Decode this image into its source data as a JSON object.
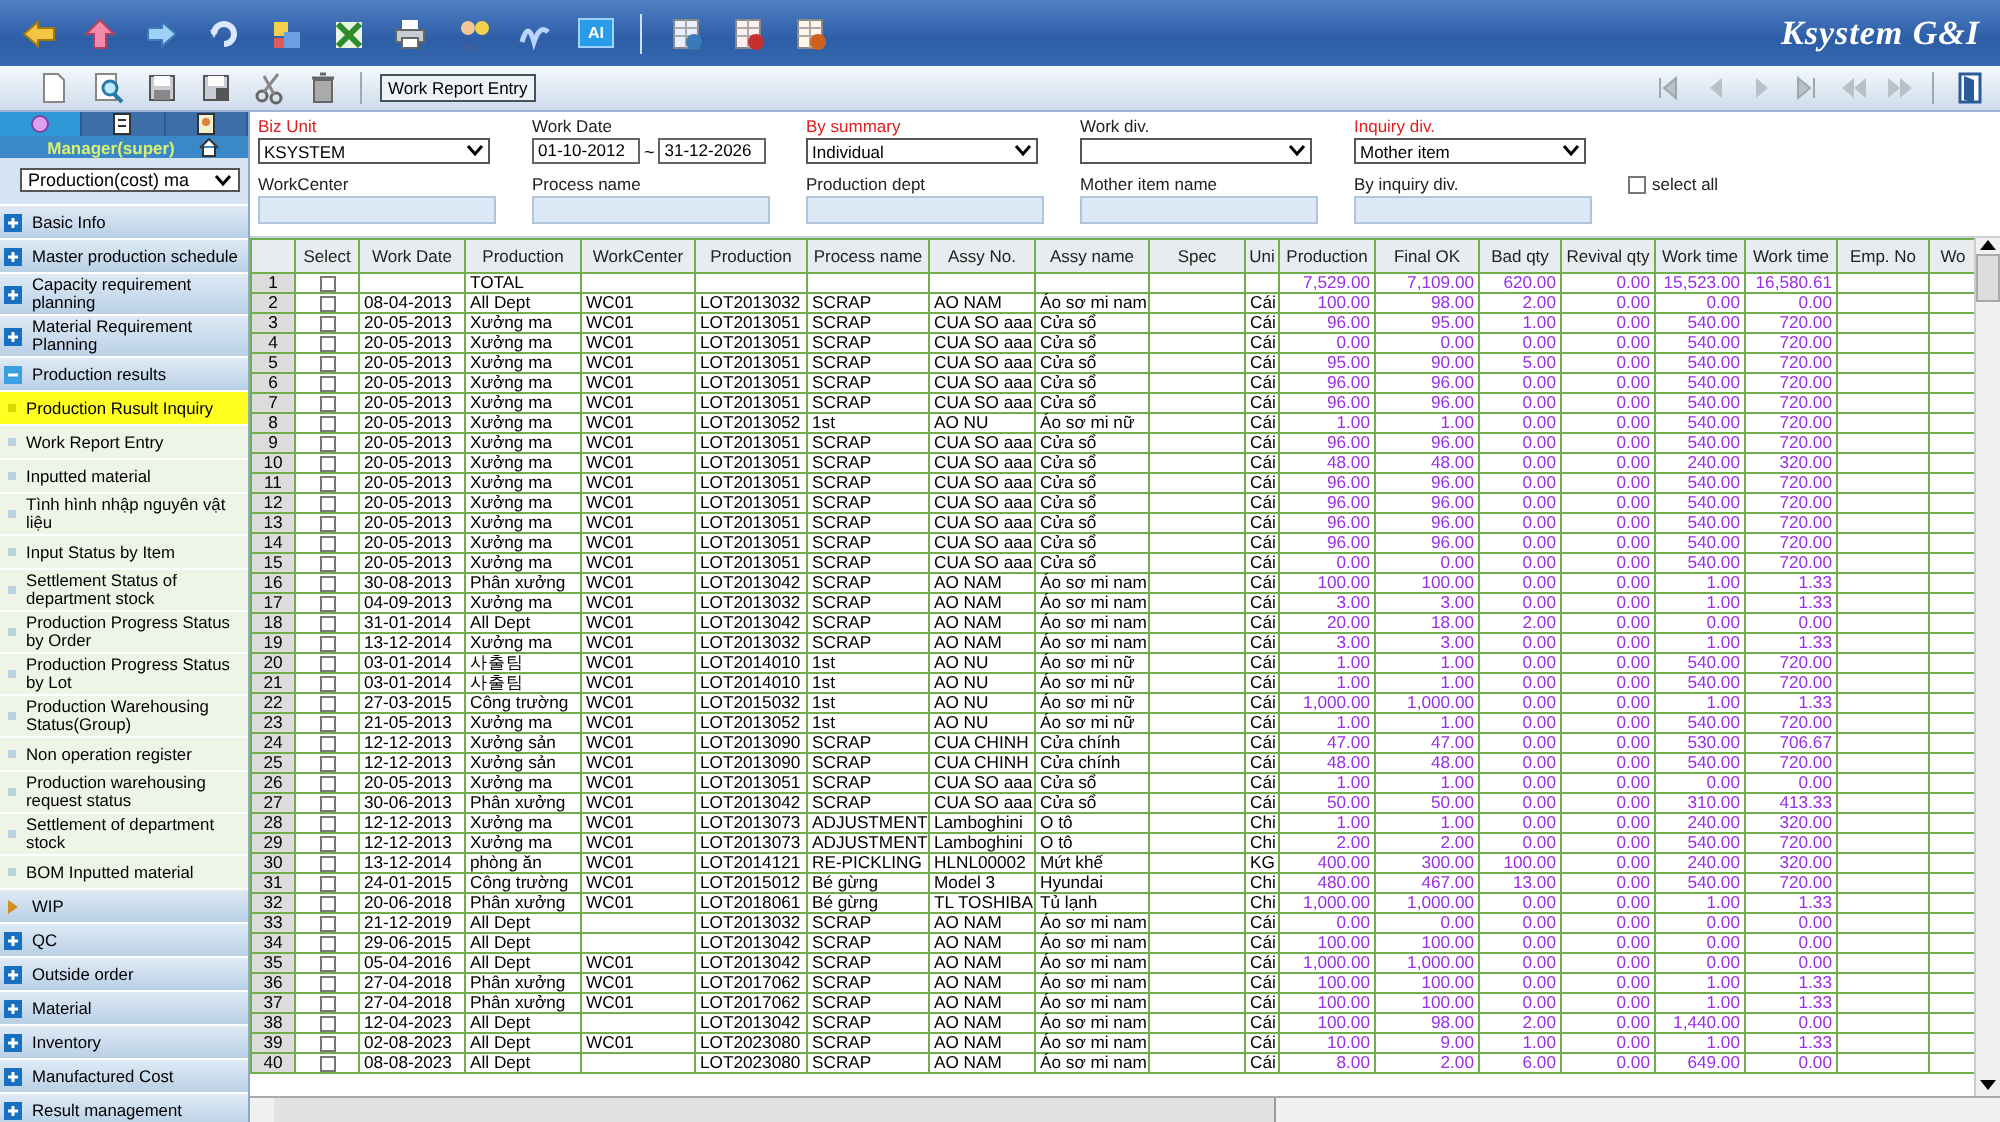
{
  "app_bar": {
    "ai_label": "AI",
    "logo": "Ksystem G&I"
  },
  "action_bar": {
    "screen_button": "Work Report Entry"
  },
  "sidebar": {
    "tabs": [
      {
        "selected": true
      },
      {
        "selected": false
      },
      {
        "selected": false
      }
    ],
    "user": "Manager(super)",
    "module_select": "Production(cost) ma",
    "items": [
      {
        "label": "Basic Info",
        "kind": "module",
        "expanded": false
      },
      {
        "label": "Master production schedule",
        "kind": "module",
        "expanded": false
      },
      {
        "label": "Capacity requirement planning",
        "kind": "module",
        "expanded": false
      },
      {
        "label": "Material Requirement Planning",
        "kind": "module",
        "expanded": false
      },
      {
        "label": "Production results",
        "kind": "module",
        "expanded": true,
        "children": [
          {
            "label": "Production Rusult Inquiry",
            "selected": true
          },
          {
            "label": "Work Report Entry",
            "selected": false
          },
          {
            "label": "Inputted material",
            "selected": false
          },
          {
            "label": "Tình hình nhập nguyên vật liệu",
            "selected": false
          },
          {
            "label": "Input Status by Item",
            "selected": false
          },
          {
            "label": "Settlement Status of department stock",
            "selected": false
          },
          {
            "label": "Production Progress Status by Order",
            "selected": false
          },
          {
            "label": "Production Progress Status by Lot",
            "selected": false
          },
          {
            "label": "Production Warehousing Status(Group)",
            "selected": false
          },
          {
            "label": "Non operation register",
            "selected": false
          },
          {
            "label": "Production warehousing request status",
            "selected": false
          },
          {
            "label": "Settlement of department stock",
            "selected": false
          },
          {
            "label": "BOM Inputted material",
            "selected": false
          }
        ]
      },
      {
        "label": "WIP",
        "kind": "folder",
        "expanded": false
      },
      {
        "label": "QC",
        "kind": "module",
        "expanded": false
      },
      {
        "label": "Outside order",
        "kind": "module",
        "expanded": false
      },
      {
        "label": "Material",
        "kind": "module",
        "expanded": false
      },
      {
        "label": "Inventory",
        "kind": "module",
        "expanded": false
      },
      {
        "label": "Manufactured Cost",
        "kind": "module",
        "expanded": false
      },
      {
        "label": "Result management",
        "kind": "module",
        "expanded": false
      }
    ]
  },
  "filters": [
    {
      "label": "Biz Unit",
      "required": true,
      "kind": "select",
      "value": "KSYSTEM"
    },
    {
      "label": "Work Date",
      "required": false,
      "kind": "date_range",
      "from": "01-10-2012",
      "separator": "~",
      "to": "31-12-2026"
    },
    {
      "label": "By summary",
      "required": true,
      "kind": "select",
      "value": "Individual"
    },
    {
      "label": "Work div.",
      "required": false,
      "kind": "select"
    },
    {
      "label": "Inquiry div.",
      "required": true,
      "kind": "select",
      "value": "Mother item"
    },
    {
      "label": "WorkCenter",
      "required": false,
      "kind": "text"
    },
    {
      "label": "Process name",
      "required": false,
      "kind": "text"
    },
    {
      "label": "Production dept",
      "required": false,
      "kind": "text"
    },
    {
      "label": "Mother item name",
      "required": false,
      "kind": "text"
    },
    {
      "label": "By inquiry div.",
      "required": false,
      "kind": "text"
    },
    {
      "label": "select all",
      "kind": "checkbox",
      "checked": false
    }
  ],
  "table": {
    "columns": [
      {
        "kind": "rownum"
      },
      {
        "label": "Select",
        "kind": "check"
      },
      {
        "label": "Work Date",
        "kind": "text"
      },
      {
        "label": "Production",
        "kind": "text"
      },
      {
        "label": "WorkCenter",
        "kind": "text"
      },
      {
        "label": "Production",
        "kind": "text"
      },
      {
        "label": "Process name",
        "kind": "text"
      },
      {
        "label": "Assy No.",
        "kind": "text"
      },
      {
        "label": "Assy name",
        "kind": "text"
      },
      {
        "label": "Spec",
        "kind": "text"
      },
      {
        "label": "Uni",
        "kind": "text"
      },
      {
        "label": "Production",
        "kind": "number"
      },
      {
        "label": "Final OK",
        "kind": "number"
      },
      {
        "label": "Bad qty",
        "kind": "number"
      },
      {
        "label": "Revival qty",
        "kind": "number"
      },
      {
        "label": "Work time",
        "kind": "number"
      },
      {
        "label": "Work time",
        "kind": "number"
      },
      {
        "label": "Emp. No",
        "kind": "text"
      },
      {
        "label": "Wo",
        "kind": "text"
      }
    ],
    "rows": [
      {
        "checked": false,
        "cells": [
          "1",
          null,
          null,
          "TOTAL",
          null,
          null,
          null,
          null,
          null,
          null,
          null,
          "7,529.00",
          "7,109.00",
          "620.00",
          "0.00",
          "15,523.00",
          "16,580.61"
        ]
      },
      {
        "checked": false,
        "cells": [
          "2",
          null,
          "08-04-2013",
          "All Dept",
          "WC01",
          "LOT2013032",
          "SCRAP",
          "AO NAM",
          "Áo sơ mi nam",
          null,
          "Cái",
          "100.00",
          "98.00",
          "2.00",
          "0.00",
          "0.00",
          "0.00"
        ]
      },
      {
        "checked": false,
        "cells": [
          "3",
          null,
          "20-05-2013",
          "Xưởng ma",
          "WC01",
          "LOT2013051",
          "SCRAP",
          "CUA SO aaa",
          "Cửa sổ",
          null,
          "Cái",
          "96.00",
          "95.00",
          "1.00",
          "0.00",
          "540.00",
          "720.00"
        ]
      },
      {
        "checked": false,
        "cells": [
          "4",
          null,
          "20-05-2013",
          "Xưởng ma",
          "WC01",
          "LOT2013051",
          "SCRAP",
          "CUA SO aaa",
          "Cửa sổ",
          null,
          "Cái",
          "0.00",
          "0.00",
          "0.00",
          "0.00",
          "540.00",
          "720.00"
        ]
      },
      {
        "checked": false,
        "cells": [
          "5",
          null,
          "20-05-2013",
          "Xưởng ma",
          "WC01",
          "LOT2013051",
          "SCRAP",
          "CUA SO aaa",
          "Cửa sổ",
          null,
          "Cái",
          "95.00",
          "90.00",
          "5.00",
          "0.00",
          "540.00",
          "720.00"
        ]
      },
      {
        "checked": false,
        "cells": [
          "6",
          null,
          "20-05-2013",
          "Xưởng ma",
          "WC01",
          "LOT2013051",
          "SCRAP",
          "CUA SO aaa",
          "Cửa sổ",
          null,
          "Cái",
          "96.00",
          "96.00",
          "0.00",
          "0.00",
          "540.00",
          "720.00"
        ]
      },
      {
        "checked": false,
        "cells": [
          "7",
          null,
          "20-05-2013",
          "Xưởng ma",
          "WC01",
          "LOT2013051",
          "SCRAP",
          "CUA SO aaa",
          "Cửa sổ",
          null,
          "Cái",
          "96.00",
          "96.00",
          "0.00",
          "0.00",
          "540.00",
          "720.00"
        ]
      },
      {
        "checked": false,
        "cells": [
          "8",
          null,
          "20-05-2013",
          "Xưởng ma",
          "WC01",
          "LOT2013052",
          "1st",
          "AO NU",
          "Áo sơ mi nữ",
          null,
          "Cái",
          "1.00",
          "1.00",
          "0.00",
          "0.00",
          "540.00",
          "720.00"
        ]
      },
      {
        "checked": false,
        "cells": [
          "9",
          null,
          "20-05-2013",
          "Xưởng ma",
          "WC01",
          "LOT2013051",
          "SCRAP",
          "CUA SO aaa",
          "Cửa sổ",
          null,
          "Cái",
          "96.00",
          "96.00",
          "0.00",
          "0.00",
          "540.00",
          "720.00"
        ]
      },
      {
        "checked": false,
        "cells": [
          "10",
          null,
          "20-05-2013",
          "Xưởng ma",
          "WC01",
          "LOT2013051",
          "SCRAP",
          "CUA SO aaa",
          "Cửa sổ",
          null,
          "Cái",
          "48.00",
          "48.00",
          "0.00",
          "0.00",
          "240.00",
          "320.00"
        ]
      },
      {
        "checked": false,
        "cells": [
          "11",
          null,
          "20-05-2013",
          "Xưởng ma",
          "WC01",
          "LOT2013051",
          "SCRAP",
          "CUA SO aaa",
          "Cửa sổ",
          null,
          "Cái",
          "96.00",
          "96.00",
          "0.00",
          "0.00",
          "540.00",
          "720.00"
        ]
      },
      {
        "checked": false,
        "cells": [
          "12",
          null,
          "20-05-2013",
          "Xưởng ma",
          "WC01",
          "LOT2013051",
          "SCRAP",
          "CUA SO aaa",
          "Cửa sổ",
          null,
          "Cái",
          "96.00",
          "96.00",
          "0.00",
          "0.00",
          "540.00",
          "720.00"
        ]
      },
      {
        "checked": false,
        "cells": [
          "13",
          null,
          "20-05-2013",
          "Xưởng ma",
          "WC01",
          "LOT2013051",
          "SCRAP",
          "CUA SO aaa",
          "Cửa sổ",
          null,
          "Cái",
          "96.00",
          "96.00",
          "0.00",
          "0.00",
          "540.00",
          "720.00"
        ]
      },
      {
        "checked": false,
        "cells": [
          "14",
          null,
          "20-05-2013",
          "Xưởng ma",
          "WC01",
          "LOT2013051",
          "SCRAP",
          "CUA SO aaa",
          "Cửa sổ",
          null,
          "Cái",
          "96.00",
          "96.00",
          "0.00",
          "0.00",
          "540.00",
          "720.00"
        ]
      },
      {
        "checked": false,
        "cells": [
          "15",
          null,
          "20-05-2013",
          "Xưởng ma",
          "WC01",
          "LOT2013051",
          "SCRAP",
          "CUA SO aaa",
          "Cửa sổ",
          null,
          "Cái",
          "0.00",
          "0.00",
          "0.00",
          "0.00",
          "540.00",
          "720.00"
        ]
      },
      {
        "checked": false,
        "cells": [
          "16",
          null,
          "30-08-2013",
          "Phân xưởng",
          "WC01",
          "LOT2013042",
          "SCRAP",
          "AO NAM",
          "Áo sơ mi nam",
          null,
          "Cái",
          "100.00",
          "100.00",
          "0.00",
          "0.00",
          "1.00",
          "1.33"
        ]
      },
      {
        "checked": false,
        "cells": [
          "17",
          null,
          "04-09-2013",
          "Xưởng ma",
          "WC01",
          "LOT2013032",
          "SCRAP",
          "AO NAM",
          "Áo sơ mi nam",
          null,
          "Cái",
          "3.00",
          "3.00",
          "0.00",
          "0.00",
          "1.00",
          "1.33"
        ]
      },
      {
        "checked": false,
        "cells": [
          "18",
          null,
          "31-01-2014",
          "All Dept",
          "WC01",
          "LOT2013042",
          "SCRAP",
          "AO NAM",
          "Áo sơ mi nam",
          null,
          "Cái",
          "20.00",
          "18.00",
          "2.00",
          "0.00",
          "0.00",
          "0.00"
        ]
      },
      {
        "checked": false,
        "cells": [
          "19",
          null,
          "13-12-2014",
          "Xưởng ma",
          "WC01",
          "LOT2013032",
          "SCRAP",
          "AO NAM",
          "Áo sơ mi nam",
          null,
          "Cái",
          "3.00",
          "3.00",
          "0.00",
          "0.00",
          "1.00",
          "1.33"
        ]
      },
      {
        "checked": false,
        "cells": [
          "20",
          null,
          "03-01-2014",
          "사출팀",
          "WC01",
          "LOT2014010",
          "1st",
          "AO NU",
          "Áo sơ mi nữ",
          null,
          "Cái",
          "1.00",
          "1.00",
          "0.00",
          "0.00",
          "540.00",
          "720.00"
        ]
      },
      {
        "checked": false,
        "cells": [
          "21",
          null,
          "03-01-2014",
          "사출팀",
          "WC01",
          "LOT2014010",
          "1st",
          "AO NU",
          "Áo sơ mi nữ",
          null,
          "Cái",
          "1.00",
          "1.00",
          "0.00",
          "0.00",
          "540.00",
          "720.00"
        ]
      },
      {
        "checked": false,
        "cells": [
          "22",
          null,
          "27-03-2015",
          "Công trường",
          "WC01",
          "LOT2015032",
          "1st",
          "AO NU",
          "Áo sơ mi nữ",
          null,
          "Cái",
          "1,000.00",
          "1,000.00",
          "0.00",
          "0.00",
          "1.00",
          "1.33"
        ]
      },
      {
        "checked": false,
        "cells": [
          "23",
          null,
          "21-05-2013",
          "Xưởng ma",
          "WC01",
          "LOT2013052",
          "1st",
          "AO NU",
          "Áo sơ mi nữ",
          null,
          "Cái",
          "1.00",
          "1.00",
          "0.00",
          "0.00",
          "540.00",
          "720.00"
        ]
      },
      {
        "checked": false,
        "cells": [
          "24",
          null,
          "12-12-2013",
          "Xưởng sản",
          "WC01",
          "LOT2013090",
          "SCRAP",
          "CUA CHINH",
          "Cửa chính",
          null,
          "Cái",
          "47.00",
          "47.00",
          "0.00",
          "0.00",
          "530.00",
          "706.67"
        ]
      },
      {
        "checked": false,
        "cells": [
          "25",
          null,
          "12-12-2013",
          "Xưởng sản",
          "WC01",
          "LOT2013090",
          "SCRAP",
          "CUA CHINH",
          "Cửa chính",
          null,
          "Cái",
          "48.00",
          "48.00",
          "0.00",
          "0.00",
          "540.00",
          "720.00"
        ]
      },
      {
        "checked": false,
        "cells": [
          "26",
          null,
          "20-05-2013",
          "Xưởng ma",
          "WC01",
          "LOT2013051",
          "SCRAP",
          "CUA SO aaa",
          "Cửa sổ",
          null,
          "Cái",
          "1.00",
          "1.00",
          "0.00",
          "0.00",
          "0.00",
          "0.00"
        ]
      },
      {
        "checked": false,
        "cells": [
          "27",
          null,
          "30-06-2013",
          "Phân xưởng",
          "WC01",
          "LOT2013042",
          "SCRAP",
          "CUA SO aaa",
          "Cửa sổ",
          null,
          "Cái",
          "50.00",
          "50.00",
          "0.00",
          "0.00",
          "310.00",
          "413.33"
        ]
      },
      {
        "checked": false,
        "cells": [
          "28",
          null,
          "12-12-2013",
          "Xưởng ma",
          "WC01",
          "LOT2013073",
          "ADJUSTMENT",
          "Lamboghini",
          "O tô",
          null,
          "Chi",
          "1.00",
          "1.00",
          "0.00",
          "0.00",
          "240.00",
          "320.00"
        ]
      },
      {
        "checked": false,
        "cells": [
          "29",
          null,
          "12-12-2013",
          "Xưởng ma",
          "WC01",
          "LOT2013073",
          "ADJUSTMENT",
          "Lamboghini",
          "O tô",
          null,
          "Chi",
          "2.00",
          "2.00",
          "0.00",
          "0.00",
          "540.00",
          "720.00"
        ]
      },
      {
        "checked": false,
        "cells": [
          "30",
          null,
          "13-12-2014",
          "phòng ăn",
          "WC01",
          "LOT2014121",
          "RE-PICKLING",
          "HLNL00002",
          "Mứt khế",
          null,
          "KG",
          "400.00",
          "300.00",
          "100.00",
          "0.00",
          "240.00",
          "320.00"
        ]
      },
      {
        "checked": false,
        "cells": [
          "31",
          null,
          "24-01-2015",
          "Công trường",
          "WC01",
          "LOT2015012",
          "Bé gừng",
          "Model 3",
          "Hyundai",
          null,
          "Chi",
          "480.00",
          "467.00",
          "13.00",
          "0.00",
          "540.00",
          "720.00"
        ]
      },
      {
        "checked": false,
        "cells": [
          "32",
          null,
          "20-06-2018",
          "Phân xưởng",
          "WC01",
          "LOT2018061",
          "Bé gừng",
          "TL TOSHIBA",
          "Tủ lạnh",
          null,
          "Chi",
          "1,000.00",
          "1,000.00",
          "0.00",
          "0.00",
          "1.00",
          "1.33"
        ]
      },
      {
        "checked": false,
        "cells": [
          "33",
          null,
          "21-12-2019",
          "All Dept",
          null,
          "LOT2013032",
          "SCRAP",
          "AO NAM",
          "Áo sơ mi nam",
          null,
          "Cái",
          "0.00",
          "0.00",
          "0.00",
          "0.00",
          "0.00",
          "0.00"
        ]
      },
      {
        "checked": false,
        "cells": [
          "34",
          null,
          "29-06-2015",
          "All Dept",
          null,
          "LOT2013042",
          "SCRAP",
          "AO NAM",
          "Áo sơ mi nam",
          null,
          "Cái",
          "100.00",
          "100.00",
          "0.00",
          "0.00",
          "0.00",
          "0.00"
        ]
      },
      {
        "checked": false,
        "cells": [
          "35",
          null,
          "05-04-2016",
          "All Dept",
          "WC01",
          "LOT2013042",
          "SCRAP",
          "AO NAM",
          "Áo sơ mi nam",
          null,
          "Cái",
          "1,000.00",
          "1,000.00",
          "0.00",
          "0.00",
          "0.00",
          "0.00"
        ]
      },
      {
        "checked": false,
        "cells": [
          "36",
          null,
          "27-04-2018",
          "Phân xưởng",
          "WC01",
          "LOT2017062",
          "SCRAP",
          "AO NAM",
          "Áo sơ mi nam",
          null,
          "Cái",
          "100.00",
          "100.00",
          "0.00",
          "0.00",
          "1.00",
          "1.33"
        ]
      },
      {
        "checked": false,
        "cells": [
          "37",
          null,
          "27-04-2018",
          "Phân xưởng",
          "WC01",
          "LOT2017062",
          "SCRAP",
          "AO NAM",
          "Áo sơ mi nam",
          null,
          "Cái",
          "100.00",
          "100.00",
          "0.00",
          "0.00",
          "1.00",
          "1.33"
        ]
      },
      {
        "checked": false,
        "cells": [
          "38",
          null,
          "12-04-2023",
          "All Dept",
          null,
          "LOT2013042",
          "SCRAP",
          "AO NAM",
          "Áo sơ mi nam",
          null,
          "Cái",
          "100.00",
          "98.00",
          "2.00",
          "0.00",
          "1,440.00",
          "0.00"
        ]
      },
      {
        "checked": false,
        "cells": [
          "39",
          null,
          "02-08-2023",
          "All Dept",
          "WC01",
          "LOT2023080",
          "SCRAP",
          "AO NAM",
          "Áo sơ mi nam",
          null,
          "Cái",
          "10.00",
          "9.00",
          "1.00",
          "0.00",
          "1.00",
          "1.33"
        ]
      },
      {
        "checked": false,
        "cells": [
          "40",
          null,
          "08-08-2023",
          "All Dept",
          null,
          "LOT2023080",
          "SCRAP",
          "AO NAM",
          "Áo sơ mi nam",
          null,
          "Cái",
          "8.00",
          "2.00",
          "6.00",
          "0.00",
          "649.00",
          "0.00"
        ]
      }
    ]
  }
}
